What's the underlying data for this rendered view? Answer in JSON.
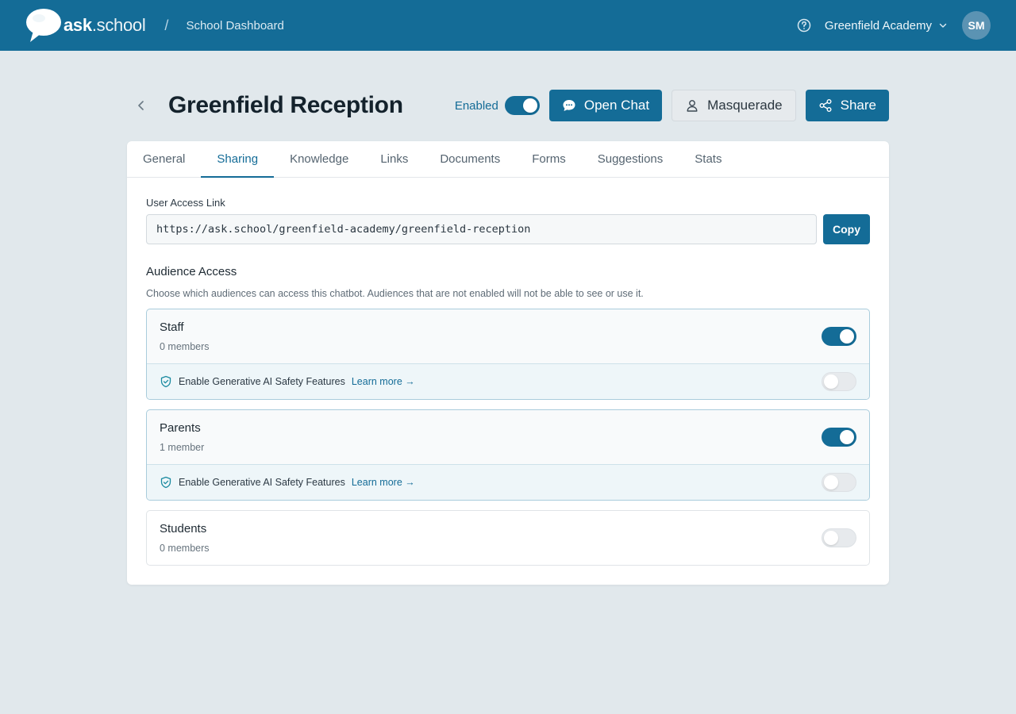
{
  "topbar": {
    "logo_bold": "ask",
    "logo_rest": ".school",
    "separator": "/",
    "breadcrumb": "School Dashboard",
    "org_name": "Greenfield Academy",
    "avatar_initials": "SM"
  },
  "header": {
    "title": "Greenfield Reception",
    "enabled_label": "Enabled",
    "enabled": true,
    "open_chat_label": "Open Chat",
    "masquerade_label": "Masquerade",
    "share_label": "Share"
  },
  "tabs": [
    {
      "label": "General"
    },
    {
      "label": "Sharing",
      "active": true
    },
    {
      "label": "Knowledge"
    },
    {
      "label": "Links"
    },
    {
      "label": "Documents"
    },
    {
      "label": "Forms"
    },
    {
      "label": "Suggestions"
    },
    {
      "label": "Stats"
    }
  ],
  "sharing": {
    "access_link_label": "User Access Link",
    "access_link_value": "https://ask.school/greenfield-academy/greenfield-reception",
    "copy_label": "Copy",
    "audience_title": "Audience Access",
    "audience_desc": "Choose which audiences can access this chatbot. Audiences that are not enabled will not be able to see or use it.",
    "audiences": [
      {
        "name": "Staff",
        "count": "0 members",
        "enabled": true,
        "safety_label": "Enable Generative AI Safety Features",
        "learn_more": "Learn more →",
        "safety_enabled": false
      },
      {
        "name": "Parents",
        "count": "1 member",
        "enabled": true,
        "safety_label": "Enable Generative AI Safety Features",
        "learn_more": "Learn more →",
        "safety_enabled": false
      },
      {
        "name": "Students",
        "count": "0 members",
        "enabled": false
      }
    ]
  },
  "colors": {
    "brand": "#146c97",
    "background": "#e1e8ec"
  }
}
